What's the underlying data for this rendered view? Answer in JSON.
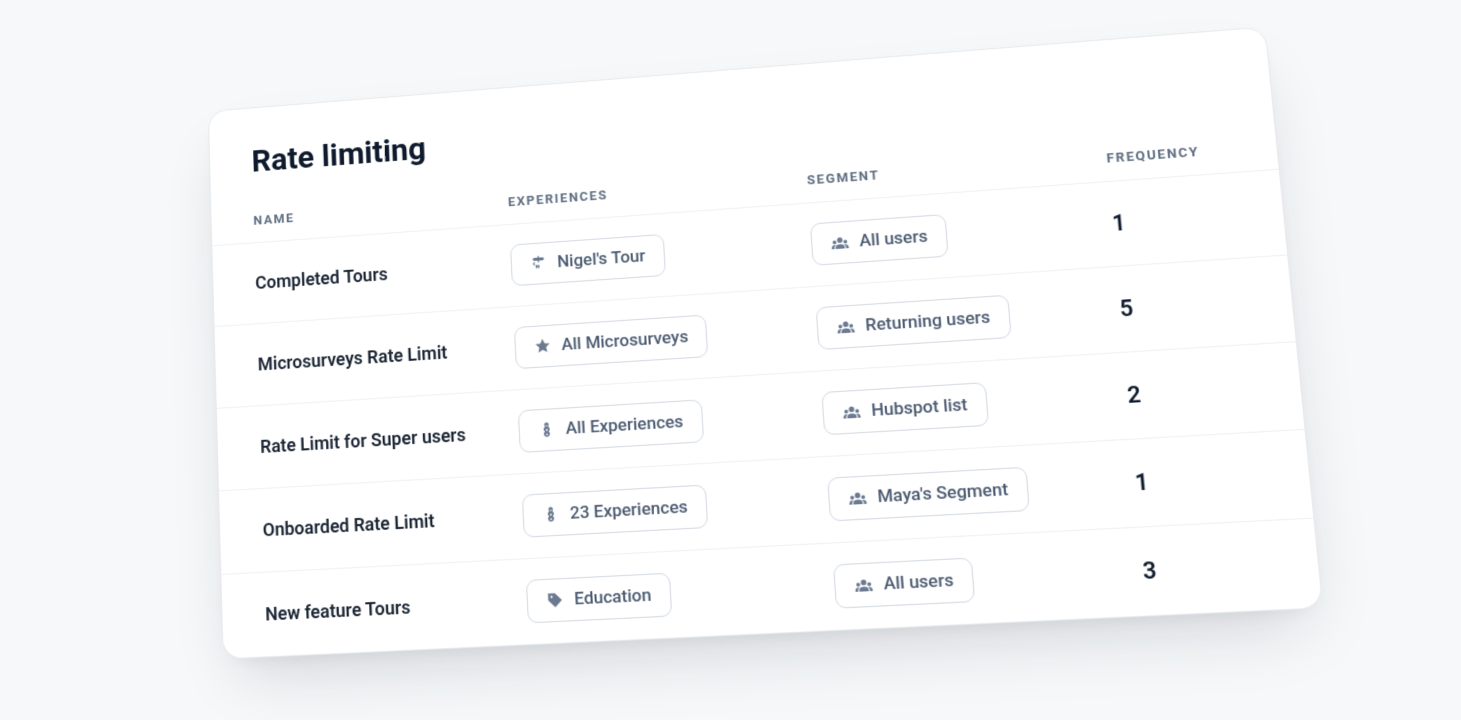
{
  "title": "Rate limiting",
  "columns": {
    "name": "NAME",
    "experiences": "EXPERIENCES",
    "segment": "SEGMENT",
    "frequency": "FREQUENCY"
  },
  "rows": [
    {
      "name": "Completed Tours",
      "experience": {
        "icon": "signpost",
        "label": "Nigel's Tour"
      },
      "segment": {
        "icon": "users",
        "label": "All users"
      },
      "frequency": "1"
    },
    {
      "name": "Microsurveys Rate Limit",
      "experience": {
        "icon": "star",
        "label": "All Microsurveys"
      },
      "segment": {
        "icon": "users",
        "label": "Returning users"
      },
      "frequency": "5"
    },
    {
      "name": "Rate Limit for Super users",
      "experience": {
        "icon": "logo",
        "label": "All Experiences"
      },
      "segment": {
        "icon": "users",
        "label": "Hubspot list"
      },
      "frequency": "2"
    },
    {
      "name": "Onboarded Rate Limit",
      "experience": {
        "icon": "logo",
        "label": "23 Experiences"
      },
      "segment": {
        "icon": "users",
        "label": "Maya's Segment"
      },
      "frequency": "1"
    },
    {
      "name": "New feature Tours",
      "experience": {
        "icon": "tag",
        "label": "Education"
      },
      "segment": {
        "icon": "users",
        "label": "All users"
      },
      "frequency": "3"
    }
  ]
}
